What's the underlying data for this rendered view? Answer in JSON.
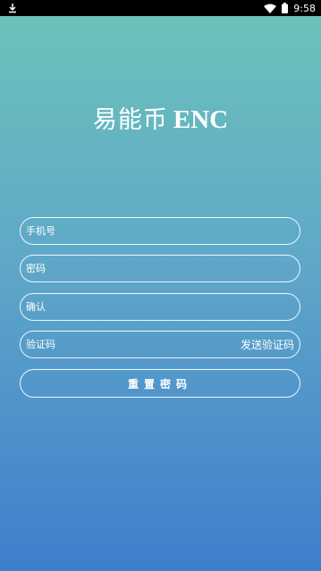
{
  "statusbar": {
    "time": "9:58",
    "icons": [
      "download-icon",
      "wifi-icon",
      "battery-icon"
    ]
  },
  "logo": {
    "chinese": "易能币",
    "english": "ENC"
  },
  "form": {
    "phone_placeholder": "手机号",
    "password_placeholder": "密码",
    "confirm_placeholder": "确认",
    "code_placeholder": "验证码",
    "send_code_label": "发送验证码",
    "submit_label": "重置密码"
  },
  "colors": {
    "gradient_top": "#6cc4b9",
    "gradient_bottom": "#3d7fcc"
  }
}
